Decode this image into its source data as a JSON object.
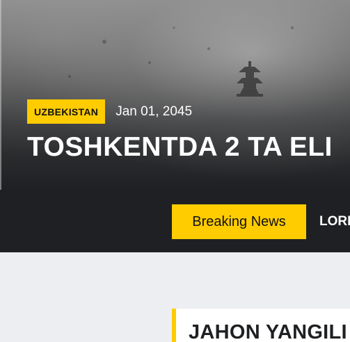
{
  "hero": {
    "category": "UZBEKISTAN",
    "date": "Jan 01, 2045",
    "title": "TOSHKENTDA 2 TA ELI"
  },
  "ticker": {
    "label": "Breaking News",
    "text": "LORI"
  },
  "section": {
    "title": "JAHON YANGILI"
  },
  "colors": {
    "accent": "#ffcc00",
    "dark": "#1f2023",
    "page_bg": "#edeef2"
  }
}
